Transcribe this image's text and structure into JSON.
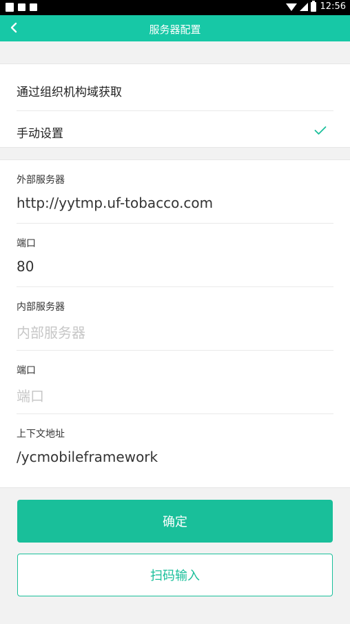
{
  "status_bar": {
    "time": "12:56",
    "left_icons": [
      "notification-icon",
      "message-icon",
      "app-icon"
    ],
    "right_icons": [
      "wifi-icon",
      "signal-icon",
      "battery-icon"
    ]
  },
  "app_bar": {
    "title": "服务器配置",
    "back_icon": "back-arrow-icon",
    "color": "#17c8a6"
  },
  "options": [
    {
      "label": "通过组织机构域获取",
      "selected": false
    },
    {
      "label": "手动设置",
      "selected": true
    }
  ],
  "fields": [
    {
      "label": "外部服务器",
      "value": "http://yytmp.uf-tobacco.com",
      "placeholder": ""
    },
    {
      "label": "端口",
      "value": "80",
      "placeholder": ""
    },
    {
      "label": "内部服务器",
      "value": "",
      "placeholder": "内部服务器"
    },
    {
      "label": "端口",
      "value": "",
      "placeholder": "端口"
    },
    {
      "label": "上下文地址",
      "value": "/ycmobileframework",
      "placeholder": ""
    }
  ],
  "buttons": {
    "confirm": "确定",
    "scan": "扫码输入"
  },
  "colors": {
    "accent": "#19bf9a",
    "placeholder": "#c7c7c7"
  }
}
